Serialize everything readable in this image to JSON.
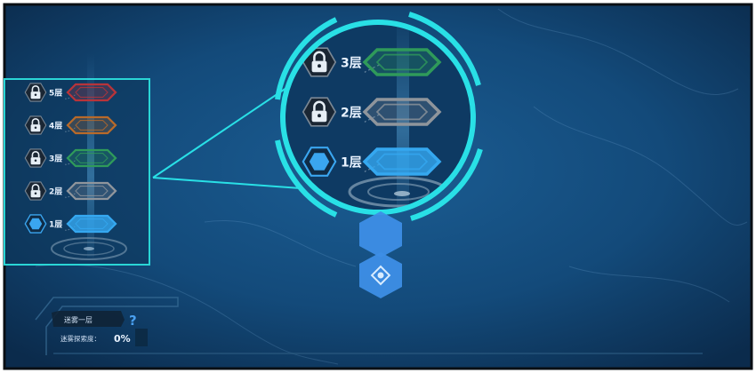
{
  "floor_map": {
    "floors": [
      {
        "label": "5层",
        "locked": true,
        "color": "#b8343a"
      },
      {
        "label": "4层",
        "locked": true,
        "color": "#b86a2a"
      },
      {
        "label": "3层",
        "locked": true,
        "color": "#2f9a5a"
      },
      {
        "label": "2层",
        "locked": true,
        "color": "#8f959c"
      },
      {
        "label": "1层",
        "locked": false,
        "color": "#35a8f0"
      }
    ],
    "zoom_floors": [
      {
        "label": "3层",
        "locked": true,
        "color": "#2f9a5a"
      },
      {
        "label": "2层",
        "locked": true,
        "color": "#8f959c"
      },
      {
        "label": "1层",
        "locked": false,
        "color": "#35a8f0"
      }
    ]
  },
  "progress": {
    "title": "迷雾一层",
    "label": "迷雾探索度：",
    "value": "0%",
    "help": "?"
  },
  "colors": {
    "accent": "#29e0e6",
    "node": "#3d8ee6",
    "panel_border": "#2ad6d6"
  },
  "icons": {
    "lock": "lock-icon",
    "current": "hexagon-marker-icon",
    "target": "crosshair-icon",
    "help": "question-mark-icon"
  }
}
